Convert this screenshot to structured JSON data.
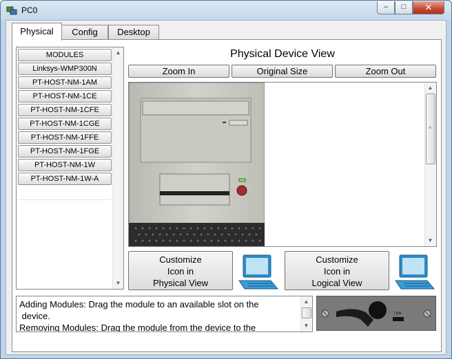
{
  "window": {
    "title": "PC0",
    "controls": {
      "minimize": "‒",
      "maximize": "□",
      "close": "✕"
    }
  },
  "tabs": [
    {
      "label": "Physical",
      "active": true
    },
    {
      "label": "Config",
      "active": false
    },
    {
      "label": "Desktop",
      "active": false
    }
  ],
  "modules": {
    "header": "MODULES",
    "items": [
      "Linksys-WMP300N",
      "PT-HOST-NM-1AM",
      "PT-HOST-NM-1CE",
      "PT-HOST-NM-1CFE",
      "PT-HOST-NM-1CGE",
      "PT-HOST-NM-1FFE",
      "PT-HOST-NM-1FGE",
      "PT-HOST-NM-1W",
      "PT-HOST-NM-1W-A"
    ]
  },
  "physical_view": {
    "title": "Physical Device View",
    "zoom_in": "Zoom In",
    "original_size": "Original Size",
    "zoom_out": "Zoom Out"
  },
  "customize": {
    "physical": [
      "Customize",
      "Icon in",
      "Physical View"
    ],
    "logical": [
      "Customize",
      "Icon in",
      "Logical View"
    ]
  },
  "info": {
    "line1": "Adding Modules: Drag the module to an available slot on the",
    "line2": " device.",
    "line3": "Removing Modules: Drag the module from the device to the"
  },
  "module_preview": {
    "port_label": "LINK"
  },
  "colors": {
    "title_bar": "#c4d7ea",
    "close_button": "#c64934",
    "device_case": "#c8c8c0",
    "preview_bg": "#7d7d7d"
  }
}
